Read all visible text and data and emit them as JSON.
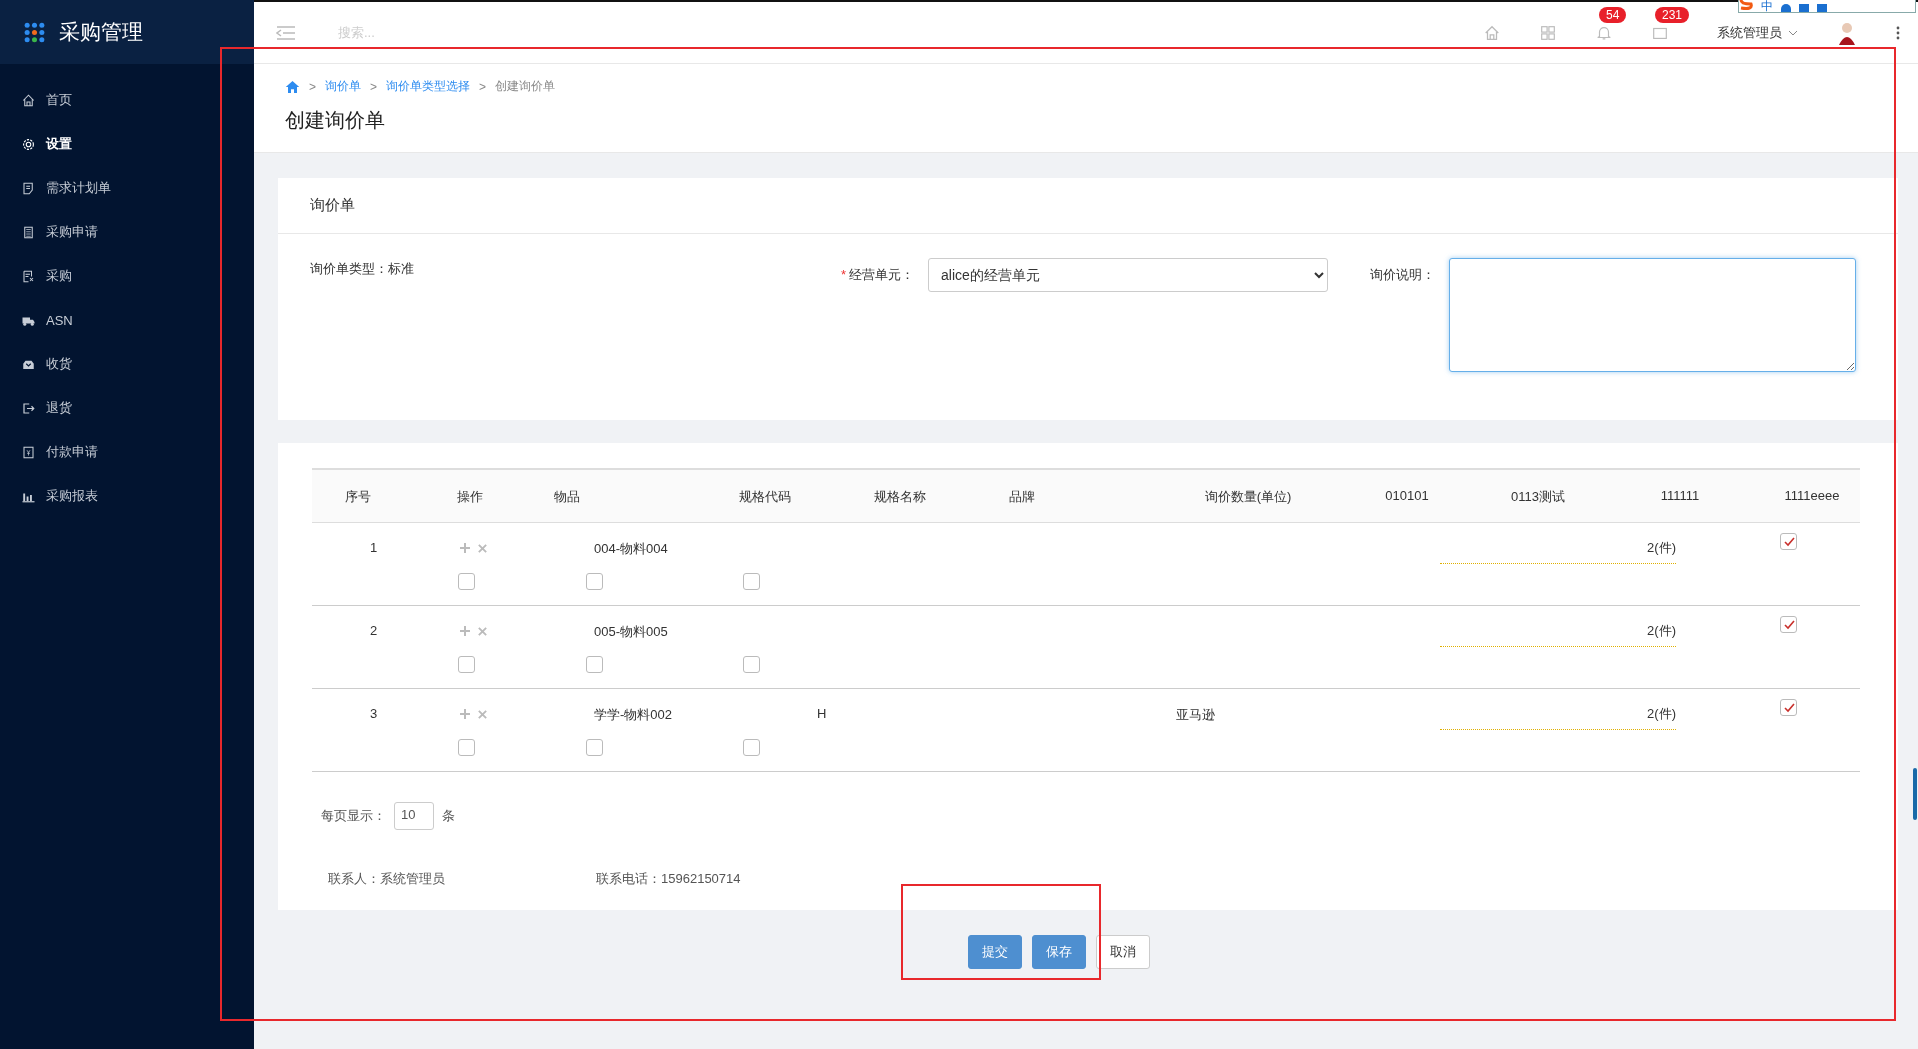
{
  "sidebar": {
    "title": "采购管理",
    "items": [
      {
        "label": "首页",
        "selected": false
      },
      {
        "label": "设置",
        "selected": true
      },
      {
        "label": "需求计划单",
        "selected": false
      },
      {
        "label": "采购申请",
        "selected": false
      },
      {
        "label": "采购",
        "selected": false
      },
      {
        "label": "ASN",
        "selected": false
      },
      {
        "label": "收货",
        "selected": false
      },
      {
        "label": "退货",
        "selected": false
      },
      {
        "label": "付款申请",
        "selected": false
      },
      {
        "label": "采购报表",
        "selected": false
      }
    ]
  },
  "topbar": {
    "search": {
      "placeholder": "搜索..."
    },
    "icons": [
      {
        "kind": "home"
      },
      {
        "kind": "grid"
      },
      {
        "kind": "bell",
        "badge": "54"
      },
      {
        "kind": "mail",
        "badge": "231"
      }
    ],
    "user": "系统管理员",
    "ime": {
      "mode": "中"
    }
  },
  "breadcrumb": [
    {
      "separator": ">",
      "label": "询价单",
      "link": true
    },
    {
      "separator": ">",
      "label": "询价单类型选择",
      "link": true
    },
    {
      "separator": ">",
      "label": "创建询价单",
      "link": false
    }
  ],
  "page_title": "创建询价单",
  "form": {
    "title": "询价单",
    "type_label": "询价单类型：",
    "type_value": "标准",
    "required_mark": "*",
    "unit_label": "经营单元：",
    "unit_value": "alice的经营单元",
    "note_label": "询价说明："
  },
  "table": {
    "columns": [
      "序号",
      "操作",
      "物品",
      "规格代码",
      "规格名称",
      "品牌",
      "询价数量(单位)",
      "010101",
      "0113测试",
      "111111",
      "1111eeee"
    ],
    "rows": [
      {
        "index": "1",
        "item": "004-物料004",
        "spec_code": "",
        "brand": "",
        "quantity": "2(件)",
        "checked": true,
        "options": [
          {
            "checked": false
          },
          {
            "checked": false
          },
          {
            "checked": false
          }
        ]
      },
      {
        "index": "2",
        "item": "005-物料005",
        "spec_code": "",
        "brand": "",
        "quantity": "2(件)",
        "checked": true,
        "options": [
          {
            "checked": false
          },
          {
            "checked": false
          },
          {
            "checked": false
          }
        ]
      },
      {
        "index": "3",
        "item": "学学-物料002",
        "spec_code": "H",
        "brand": "亚马逊",
        "quantity": "2(件)",
        "checked": true,
        "options": [
          {
            "checked": false
          },
          {
            "checked": false
          },
          {
            "checked": false
          }
        ]
      }
    ]
  },
  "page_size": {
    "label": "每页显示：",
    "value": "10",
    "unit": "条"
  },
  "contact": {
    "person_label": "联系人：",
    "person": "系统管理员",
    "phone_label": "联系电话：",
    "phone": "15962150714"
  },
  "buttons": [
    {
      "label": "提交",
      "kind": "primary"
    },
    {
      "label": "保存",
      "kind": "primary"
    },
    {
      "label": "取消",
      "kind": "default"
    }
  ]
}
